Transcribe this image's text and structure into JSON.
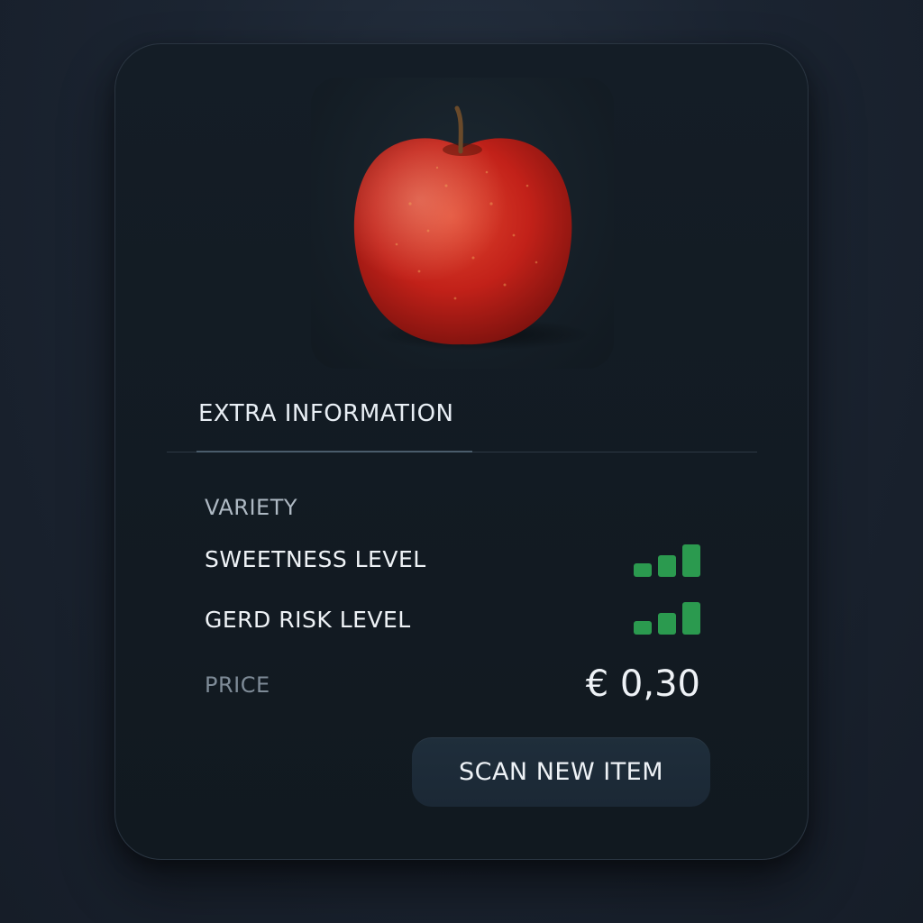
{
  "product": {
    "image_icon": "apple-photo",
    "colors": {
      "apple": "#c8231b",
      "stem": "#6a4a2a"
    }
  },
  "tabs": {
    "active_label": "EXTRA INFORMATION"
  },
  "details": {
    "variety_label": "VARIETY",
    "sweetness_label": "SWEETNESS LEVEL",
    "sweetness_level": {
      "filled": 3,
      "max": 3
    },
    "gerd_label": "GERD RISK LEVEL",
    "gerd_level": {
      "filled": 3,
      "max": 3
    },
    "price_label": "PRICE",
    "price_value": "€ 0,30",
    "level_color": "#2b9a4f"
  },
  "actions": {
    "scan_label": "SCAN NEW ITEM"
  }
}
